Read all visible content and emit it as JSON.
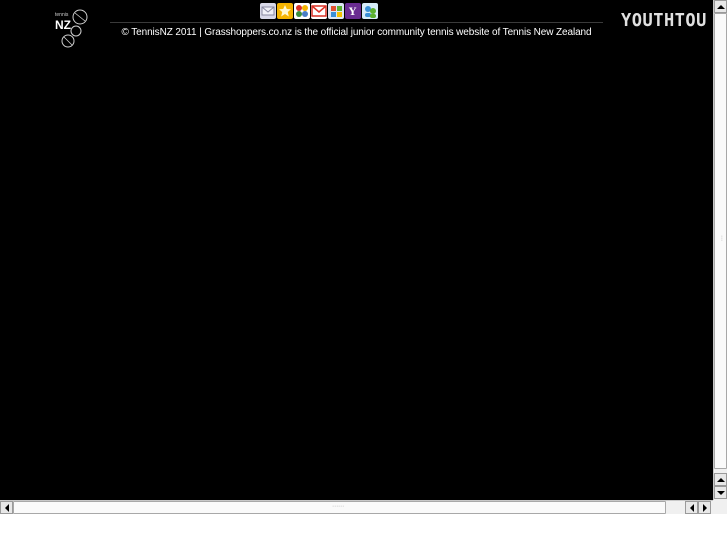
{
  "footer": {
    "copyright": "© TennisNZ 2011 | Grasshoppers.co.nz is the official junior community tennis website of Tennis New Zealand",
    "logo_small_text": "tennis",
    "logo_main_text": "NZ"
  },
  "brand_banner": {
    "text": "YOUTHTOU"
  },
  "share_icons": [
    {
      "name": "email-share-icon",
      "color": "#d8d8e8"
    },
    {
      "name": "favorites-share-icon",
      "color": "#f5b400"
    },
    {
      "name": "google-bookmarks-share-icon",
      "color": "#3b8d3b"
    },
    {
      "name": "gmail-share-icon",
      "color": "#d93025"
    },
    {
      "name": "windows-live-share-icon",
      "color": "#4a7ec7"
    },
    {
      "name": "yahoo-share-icon",
      "color": "#6a2c91"
    },
    {
      "name": "messenger-share-icon",
      "color": "#3a8fd6"
    }
  ],
  "colors": {
    "page_background": "#000000",
    "text": "#ffffff"
  }
}
